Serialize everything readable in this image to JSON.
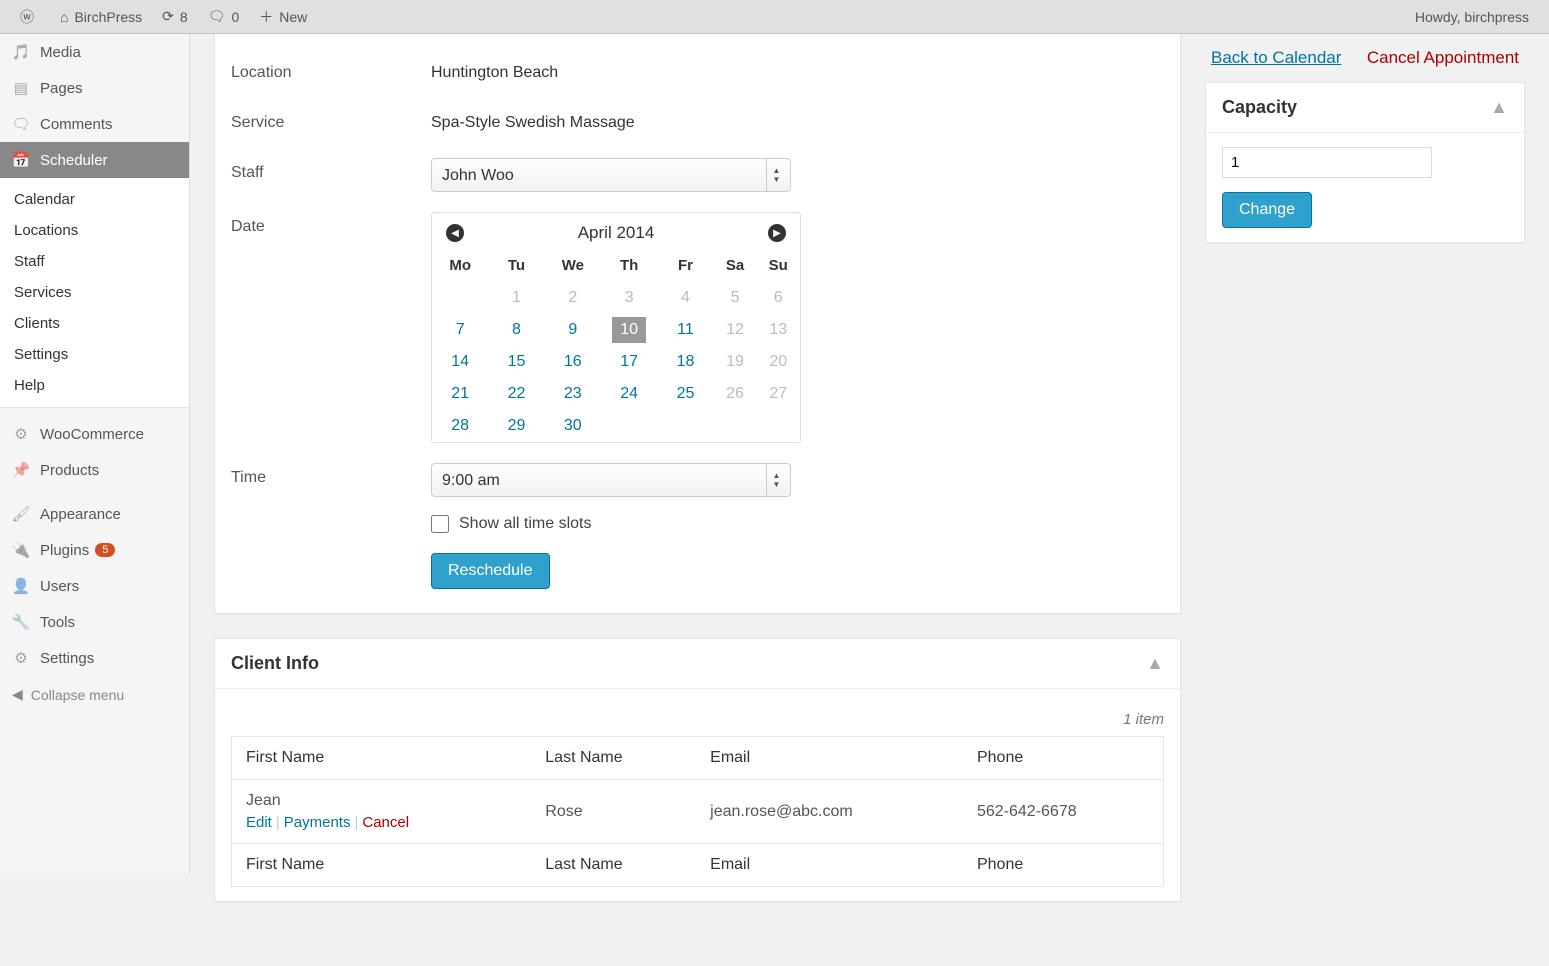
{
  "adminbar": {
    "site_name": "BirchPress",
    "updates": "8",
    "comments": "0",
    "new_label": "New",
    "howdy": "Howdy, birchpress"
  },
  "sidebar": {
    "items": [
      {
        "label": "Media",
        "icon": "media"
      },
      {
        "label": "Pages",
        "icon": "page"
      },
      {
        "label": "Comments",
        "icon": "comment"
      },
      {
        "label": "Scheduler",
        "icon": "calendar",
        "current": true
      },
      {
        "label": "WooCommerce",
        "icon": "gear"
      },
      {
        "label": "Products",
        "icon": "pin"
      },
      {
        "label": "Appearance",
        "icon": "brush"
      },
      {
        "label": "Plugins",
        "icon": "plug",
        "badge": "5"
      },
      {
        "label": "Users",
        "icon": "user"
      },
      {
        "label": "Tools",
        "icon": "wrench"
      },
      {
        "label": "Settings",
        "icon": "settings"
      }
    ],
    "submenu": [
      "Calendar",
      "Locations",
      "Staff",
      "Services",
      "Clients",
      "Settings",
      "Help"
    ],
    "collapse": "Collapse menu"
  },
  "appointment": {
    "fields": {
      "location_label": "Location",
      "location_value": "Huntington Beach",
      "service_label": "Service",
      "service_value": "Spa-Style Swedish Massage",
      "staff_label": "Staff",
      "staff_value": "John Woo",
      "date_label": "Date",
      "time_label": "Time",
      "time_value": "9:00 am",
      "show_all_label": "Show all time slots",
      "reschedule_label": "Reschedule"
    },
    "calendar": {
      "title": "April 2014",
      "dow": [
        "Mo",
        "Tu",
        "We",
        "Th",
        "Fr",
        "Sa",
        "Su"
      ],
      "weeks": [
        [
          {
            "d": "1",
            "t": "dis"
          },
          {
            "d": "2",
            "t": "dis"
          },
          {
            "d": "3",
            "t": "dis"
          },
          {
            "d": "4",
            "t": "dis"
          },
          {
            "d": "5",
            "t": "dis"
          },
          {
            "d": "6",
            "t": "dis"
          }
        ],
        [
          {
            "d": "7",
            "t": "a"
          },
          {
            "d": "8",
            "t": "a"
          },
          {
            "d": "9",
            "t": "a"
          },
          {
            "d": "10",
            "t": "sel"
          },
          {
            "d": "11",
            "t": "a"
          },
          {
            "d": "12",
            "t": "dis"
          },
          {
            "d": "13",
            "t": "dis"
          }
        ],
        [
          {
            "d": "14",
            "t": "a"
          },
          {
            "d": "15",
            "t": "a"
          },
          {
            "d": "16",
            "t": "a"
          },
          {
            "d": "17",
            "t": "a"
          },
          {
            "d": "18",
            "t": "a"
          },
          {
            "d": "19",
            "t": "dis"
          },
          {
            "d": "20",
            "t": "dis"
          }
        ],
        [
          {
            "d": "21",
            "t": "a"
          },
          {
            "d": "22",
            "t": "a"
          },
          {
            "d": "23",
            "t": "a"
          },
          {
            "d": "24",
            "t": "a"
          },
          {
            "d": "25",
            "t": "a"
          },
          {
            "d": "26",
            "t": "dis"
          },
          {
            "d": "27",
            "t": "dis"
          }
        ],
        [
          {
            "d": "28",
            "t": "a"
          },
          {
            "d": "29",
            "t": "a"
          },
          {
            "d": "30",
            "t": "a"
          }
        ]
      ]
    }
  },
  "side": {
    "back_label": "Back to Calendar",
    "cancel_label": "Cancel Appointment",
    "capacity_title": "Capacity",
    "capacity_value": "1",
    "change_label": "Change"
  },
  "clientinfo": {
    "title": "Client Info",
    "count_label": "1 item",
    "columns": [
      "First Name",
      "Last Name",
      "Email",
      "Phone"
    ],
    "rows": [
      {
        "first": "Jean",
        "last": "Rose",
        "email": "jean.rose@abc.com",
        "phone": "562-642-6678"
      }
    ],
    "actions": {
      "edit": "Edit",
      "payments": "Payments",
      "cancel": "Cancel"
    }
  }
}
